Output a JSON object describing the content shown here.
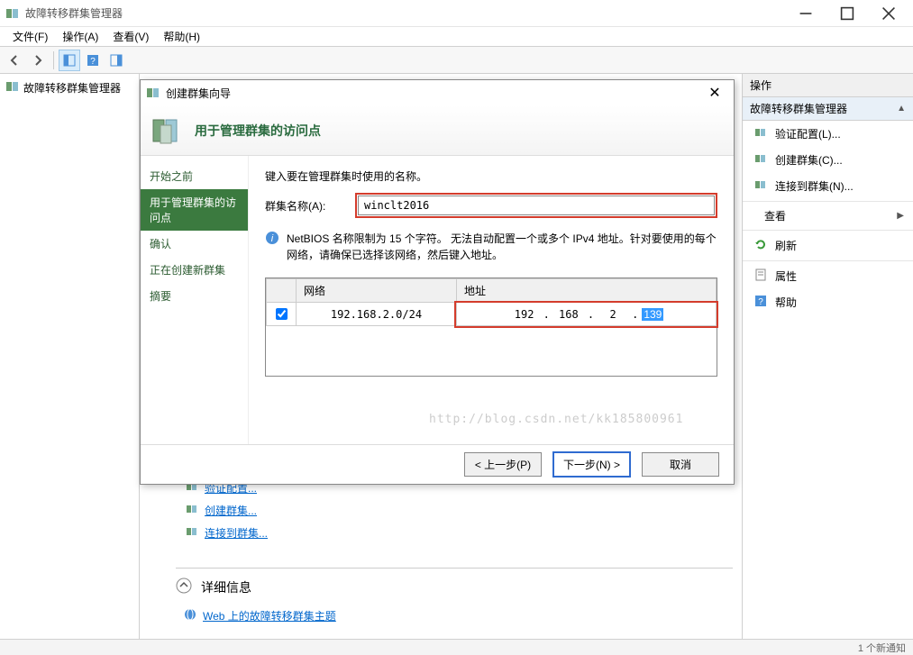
{
  "window": {
    "title": "故障转移群集管理器"
  },
  "menubar": {
    "file": "文件(F)",
    "action": "操作(A)",
    "view": "查看(V)",
    "help": "帮助(H)"
  },
  "tree": {
    "root": "故障转移群集管理器"
  },
  "actions": {
    "header": "操作",
    "group": "故障转移群集管理器",
    "validate": "验证配置(L)...",
    "create": "创建群集(C)...",
    "connect": "连接到群集(N)...",
    "view": "查看",
    "refresh": "刷新",
    "properties": "属性",
    "help": "帮助"
  },
  "content": {
    "link_validate": "验证配置...",
    "link_create": "创建群集...",
    "link_connect": "连接到群集...",
    "detail_title": "详细信息",
    "detail_link": "Web 上的故障转移群集主题"
  },
  "dialog": {
    "title": "创建群集向导",
    "header": "用于管理群集的访问点",
    "steps": {
      "s1": "开始之前",
      "s2": "用于管理群集的访问点",
      "s3": "确认",
      "s4": "正在创建新群集",
      "s5": "摘要"
    },
    "instruct": "键入要在管理群集时使用的名称。",
    "name_label": "群集名称(A):",
    "name_value": "winclt2016",
    "netbios_info": "NetBIOS 名称限制为 15 个字符。 无法自动配置一个或多个 IPv4 地址。针对要使用的每个网络，请确保已选择该网络，然后键入地址。",
    "col_network": "网络",
    "col_address": "地址",
    "network_cidr": "192.168.2.0/24",
    "ip": {
      "o1": "192",
      "o2": "168",
      "o3": "2",
      "o4": "139"
    },
    "btn_prev": "< 上一步(P)",
    "btn_next": "下一步(N) >",
    "btn_cancel": "取消"
  },
  "watermark": "http://blog.csdn.net/kk185800961",
  "status": {
    "notify": "1 个新通知"
  }
}
